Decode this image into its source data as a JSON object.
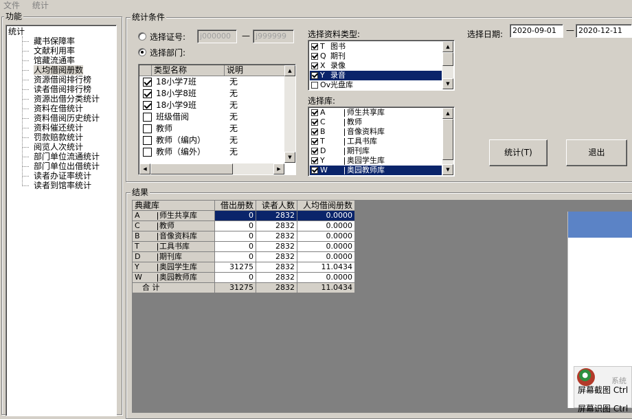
{
  "menu": [
    "文件",
    "统计"
  ],
  "func_panel": {
    "title": "功能",
    "root": "统计",
    "items": [
      "藏书保障率",
      "文献利用率",
      "馆藏流通率",
      "人均借阅册数",
      "资源借阅排行榜",
      "读者借阅排行榜",
      "资源出借分类统计",
      "资料在借统计",
      "资料借阅历史统计",
      "资料催还统计",
      "罚款赔款统计",
      "阅览人次统计",
      "部门单位流通统计",
      "部门单位出借统计",
      "读者办证率统计",
      "读者到馆率统计"
    ],
    "selected_index": 3
  },
  "conditions": {
    "title": "统计条件",
    "radio_card_label": "选择证号:",
    "card_from": "j000000",
    "card_dash": "—",
    "card_to": "j999999",
    "radio_dept_label": "选择部门:",
    "dept_headers": [
      "类型名称",
      "说明"
    ],
    "dept_rows": [
      {
        "name": "18小学7班",
        "desc": "无",
        "checked": true
      },
      {
        "name": "18小学8班",
        "desc": "无",
        "checked": true
      },
      {
        "name": "18小学9班",
        "desc": "无",
        "checked": true
      },
      {
        "name": "班级借阅",
        "desc": "无",
        "checked": false
      },
      {
        "name": "教师",
        "desc": "无",
        "checked": false
      },
      {
        "name": "教师（编内）",
        "desc": "无",
        "checked": false
      },
      {
        "name": "教师（编外）",
        "desc": "无",
        "checked": false
      }
    ],
    "type_label": "选择资料类型:",
    "types": [
      {
        "code": "T",
        "name": "图书",
        "checked": true,
        "selected": false
      },
      {
        "code": "Q",
        "name": "期刊",
        "checked": true,
        "selected": false
      },
      {
        "code": "X",
        "name": "录像",
        "checked": true,
        "selected": false
      },
      {
        "code": "Y",
        "name": "录音",
        "checked": true,
        "selected": true
      },
      {
        "code": "Ov",
        "name": "光盘库",
        "checked": false,
        "selected": false
      }
    ],
    "lib_label": "选择库:",
    "libs": [
      {
        "code": "A",
        "name": "师生共享库",
        "checked": true,
        "selected": false
      },
      {
        "code": "C",
        "name": "教师",
        "checked": true,
        "selected": false
      },
      {
        "code": "B",
        "name": "音像资料库",
        "checked": true,
        "selected": false
      },
      {
        "code": "T",
        "name": "工具书库",
        "checked": true,
        "selected": false
      },
      {
        "code": "D",
        "name": "期刊库",
        "checked": true,
        "selected": false
      },
      {
        "code": "Y",
        "name": "奥园学生库",
        "checked": true,
        "selected": false
      },
      {
        "code": "W",
        "name": "奥园教师库",
        "checked": true,
        "selected": true
      }
    ],
    "date_label": "选择日期:",
    "date_from": "2020-09-01",
    "date_dash": "—",
    "date_to": "2020-12-11",
    "stat_button": "统计(T)",
    "exit_button": "退出"
  },
  "results": {
    "title": "结果",
    "headers": [
      "典藏库",
      "借出册数",
      "读者人数",
      "人均借阅册数"
    ],
    "rows": [
      {
        "code": "A",
        "name": "师生共享库",
        "borrowed": "0",
        "readers": "2832",
        "avg": "0.0000"
      },
      {
        "code": "C",
        "name": "教师",
        "borrowed": "0",
        "readers": "2832",
        "avg": "0.0000"
      },
      {
        "code": "B",
        "name": "音像资料库",
        "borrowed": "0",
        "readers": "2832",
        "avg": "0.0000"
      },
      {
        "code": "T",
        "name": "工具书库",
        "borrowed": "0",
        "readers": "2832",
        "avg": "0.0000"
      },
      {
        "code": "D",
        "name": "期刊库",
        "borrowed": "0",
        "readers": "2832",
        "avg": "0.0000"
      },
      {
        "code": "Y",
        "name": "奥园学生库",
        "borrowed": "31275",
        "readers": "2832",
        "avg": "11.0434"
      },
      {
        "code": "W",
        "name": "奥园教师库",
        "borrowed": "0",
        "readers": "2832",
        "avg": "0.0000"
      }
    ],
    "total": {
      "label": "合 计",
      "borrowed": "31275",
      "readers": "2832",
      "avg": "11.0434"
    }
  },
  "overlay": {
    "popup_text": "系统",
    "menu1": "屏幕截图 Ctrl",
    "menu2": "屏幕识图 Ctrl"
  }
}
